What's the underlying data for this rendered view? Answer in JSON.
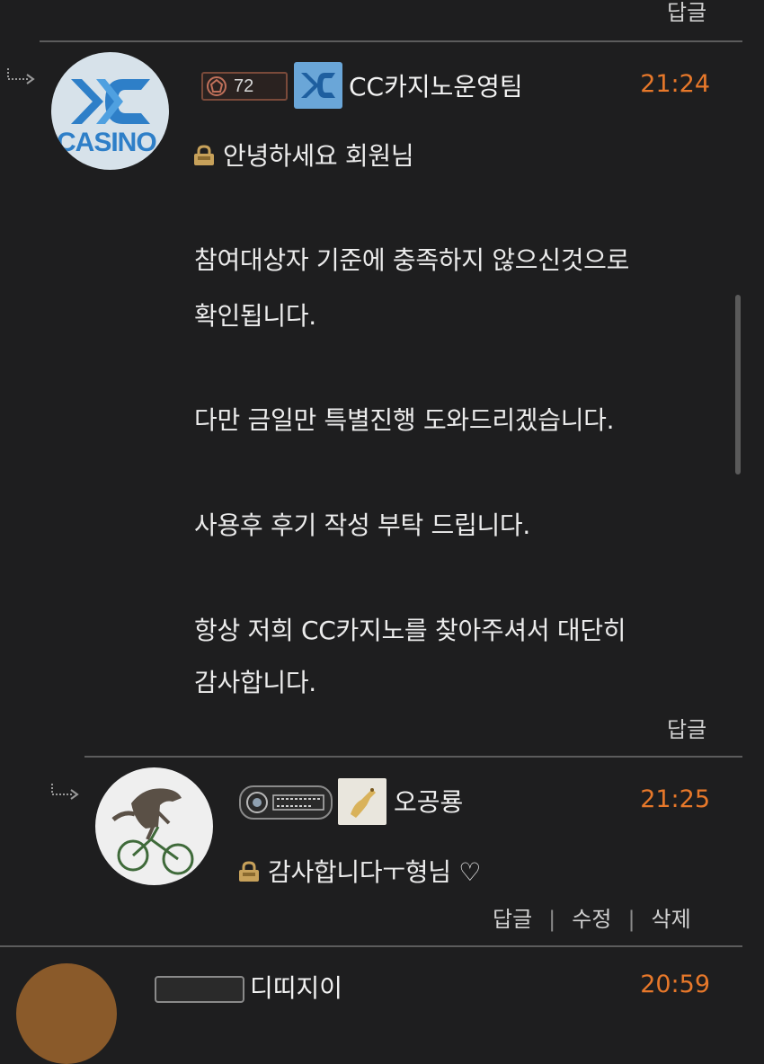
{
  "top": {
    "reply_label": "답글"
  },
  "comment1": {
    "level": "72",
    "nickname": "CC카지노운영팀",
    "time": "21:24",
    "avatar_text": "CASINO",
    "lines": [
      "안녕하세요 회원님",
      "참여대상자 기준에 충족하지 않으신것으로",
      "확인됩니다.",
      "다만 금일만 특별진행 도와드리겠습니다.",
      "사용후 후기 작성 부탁 드립니다.",
      "항상 저희 CC카지노를 찾아주셔서 대단히",
      "감사합니다."
    ],
    "reply_label": "답글"
  },
  "comment2": {
    "nickname": "오공룡",
    "time": "21:25",
    "text": "감사합니다ㅜ형님 ♡",
    "actions": {
      "reply": "답글",
      "edit": "수정",
      "delete": "삭제"
    }
  },
  "comment3": {
    "nickname": "디띠지이",
    "time": "20:59"
  },
  "colors": {
    "time": "#e7782a",
    "background": "#1e1e1f",
    "divider": "#5c5c5c"
  },
  "icons": [
    "reply-arrow-icon",
    "lock-icon",
    "level-badge-icon",
    "casino-logo-icon",
    "dinosaur-avatar-icon",
    "heart-icon"
  ]
}
